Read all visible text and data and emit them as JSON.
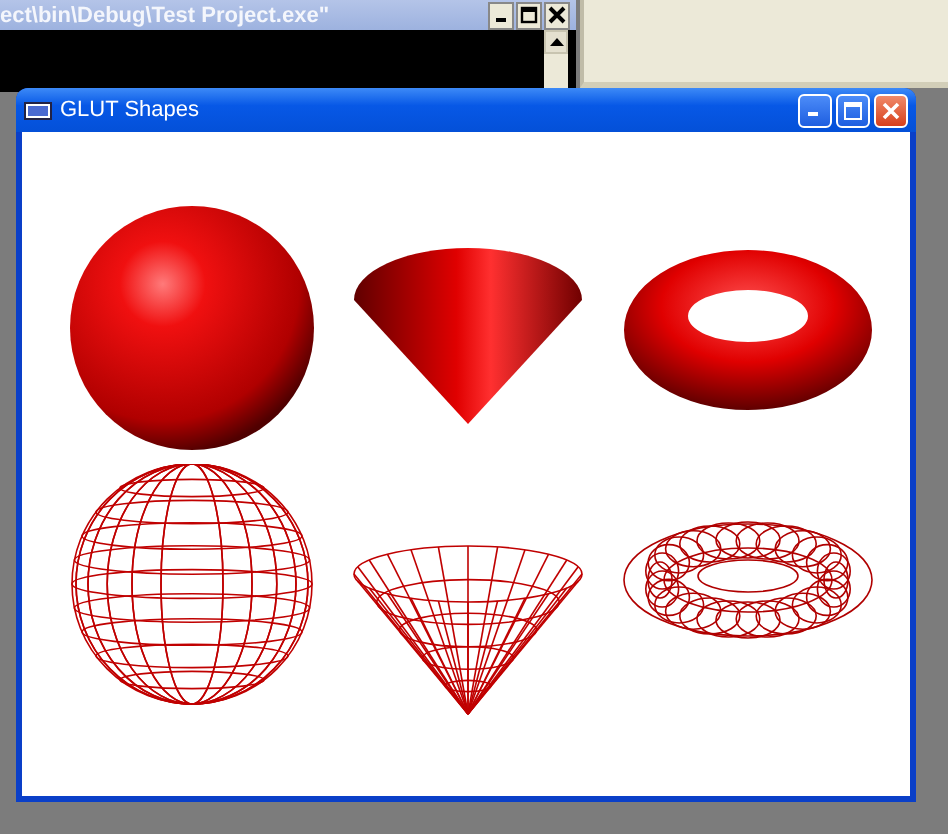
{
  "console_window": {
    "title": "ect\\bin\\Debug\\Test Project.exe\""
  },
  "glut_window": {
    "title": "GLUT Shapes",
    "shapes": [
      {
        "kind": "solid-sphere"
      },
      {
        "kind": "solid-cone"
      },
      {
        "kind": "solid-torus"
      },
      {
        "kind": "wire-sphere"
      },
      {
        "kind": "wire-cone"
      },
      {
        "kind": "wire-torus"
      }
    ]
  }
}
